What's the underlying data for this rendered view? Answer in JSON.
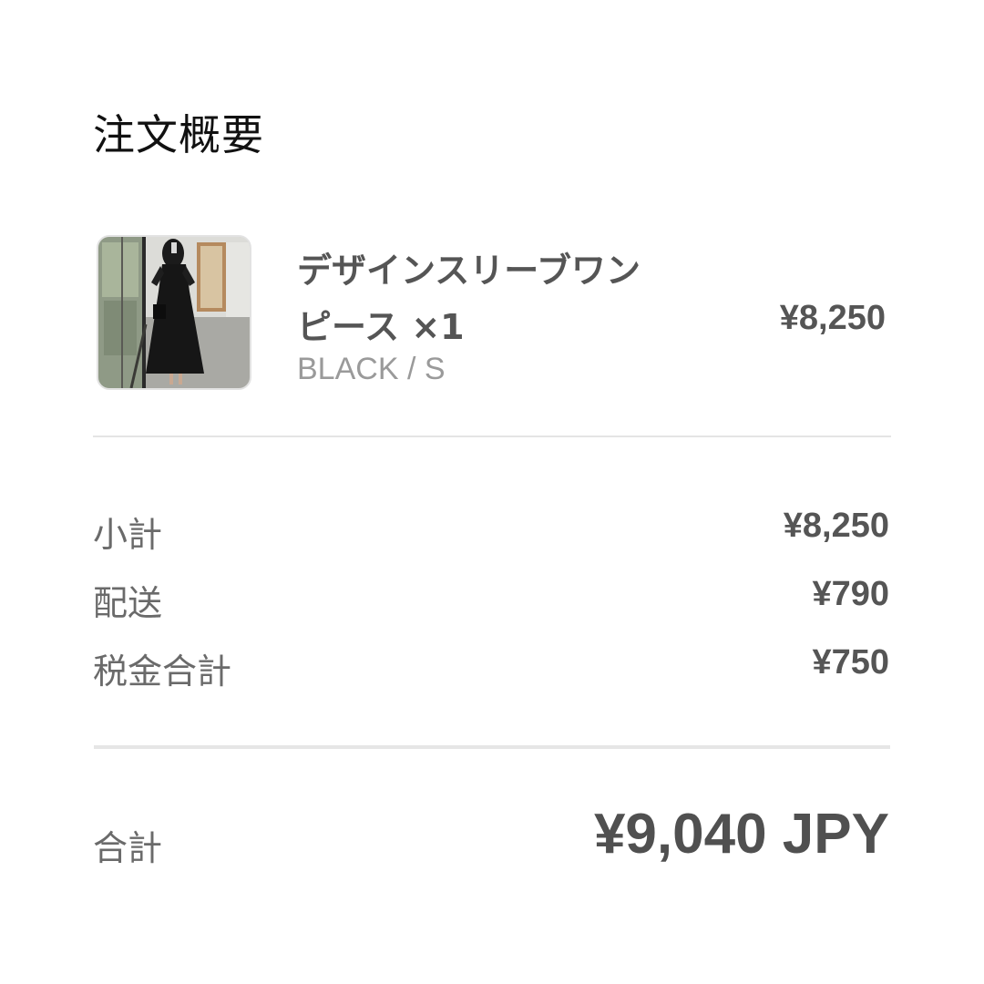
{
  "title": "注文概要",
  "item": {
    "name_line1": "デザインスリーブワン",
    "name_line2": "ピース ×1",
    "variant": "BLACK / S",
    "price": "¥8,250"
  },
  "summary": [
    {
      "label": "小計",
      "value": "¥8,250"
    },
    {
      "label": "配送",
      "value": "¥790"
    },
    {
      "label": "税金合計",
      "value": "¥750"
    }
  ],
  "total": {
    "label": "合計",
    "value": "¥9,040 JPY"
  },
  "colors": {
    "title": "#111111",
    "price": "#555555",
    "label": "#6a6a6a",
    "variant": "#9a9a9a",
    "divider": "#e4e4e4"
  }
}
